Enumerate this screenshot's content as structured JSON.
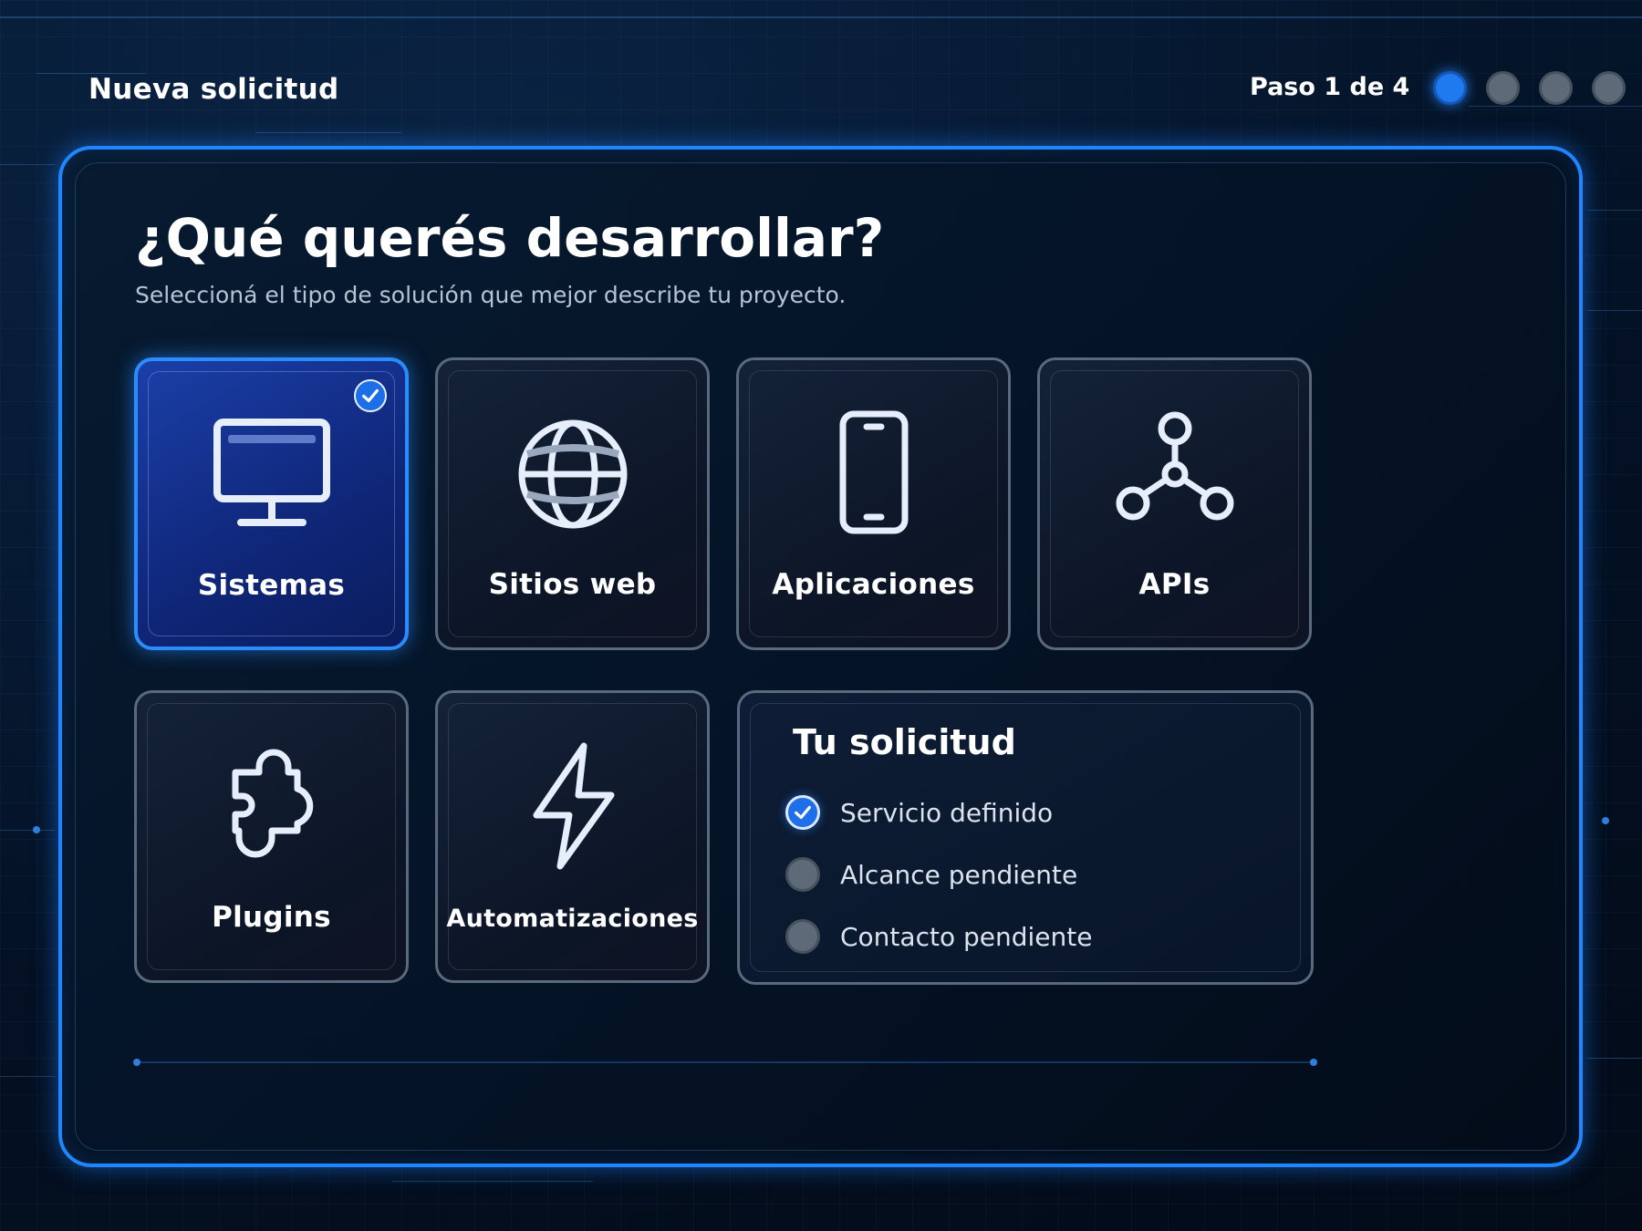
{
  "header": {
    "title": "Nueva solicitud",
    "step_label": "Paso 1 de 4",
    "steps": [
      {
        "state": "active"
      },
      {
        "state": "inactive"
      },
      {
        "state": "inactive"
      },
      {
        "state": "inactive"
      }
    ]
  },
  "main": {
    "title": "¿Qué querés desarrollar?",
    "subtitle": "Seleccioná el tipo de solución que mejor describe tu proyecto.",
    "options": [
      {
        "label": "Sistemas",
        "icon": "monitor-icon",
        "selected": true
      },
      {
        "label": "Sitios web",
        "icon": "globe-icon",
        "selected": false
      },
      {
        "label": "Aplicaciones",
        "icon": "smartphone-icon",
        "selected": false
      },
      {
        "label": "APIs",
        "icon": "api-nodes-icon",
        "selected": false
      },
      {
        "label": "Plugins",
        "icon": "puzzle-icon",
        "selected": false
      },
      {
        "label": "Automatizaciones",
        "icon": "lightning-icon",
        "selected": false
      }
    ]
  },
  "summary": {
    "title": "Tu solicitud",
    "items": [
      {
        "label": "Servicio definido",
        "status": "done"
      },
      {
        "label": "Alcance pendiente",
        "status": "pending"
      },
      {
        "label": "Contacto pendiente",
        "status": "pending"
      }
    ]
  },
  "colors": {
    "accent": "#1f86ff",
    "selected_card": "#1b3fa8",
    "background": "#04101f",
    "pending_gray": "#5e6a78"
  }
}
